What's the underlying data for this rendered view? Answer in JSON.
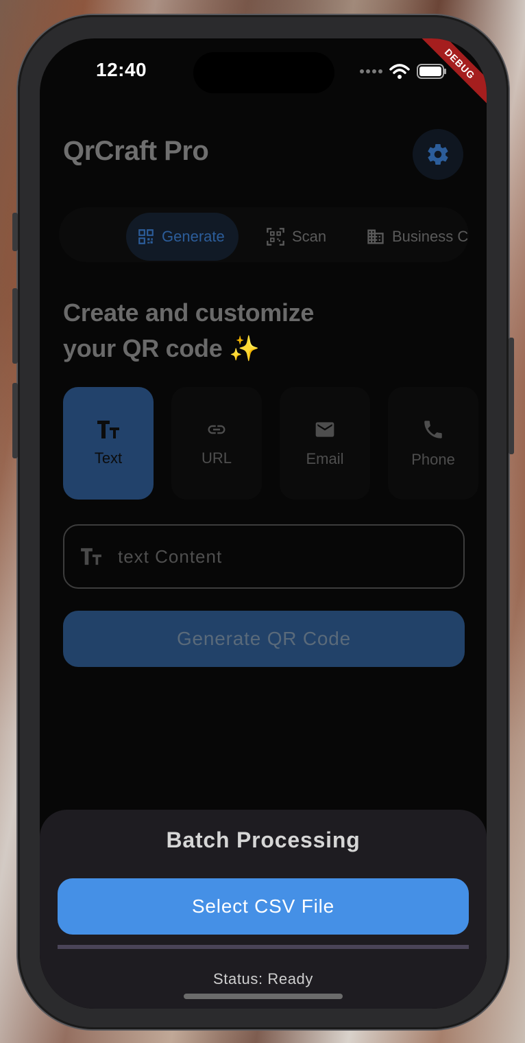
{
  "status_bar": {
    "time": "12:40"
  },
  "debug_banner": "DEBUG",
  "app": {
    "title": "QrCraft Pro"
  },
  "tabs": [
    {
      "label": "Generate",
      "icon": "qr-code-icon",
      "active": true
    },
    {
      "label": "Scan",
      "icon": "qr-scan-icon",
      "active": false
    },
    {
      "label": "Business C",
      "icon": "business-icon",
      "active": false
    }
  ],
  "headline": {
    "line1": "Create and customize",
    "line2": "your QR code ✨"
  },
  "content_types": [
    {
      "label": "Text",
      "icon": "text-icon",
      "active": true
    },
    {
      "label": "URL",
      "icon": "link-icon",
      "active": false
    },
    {
      "label": "Email",
      "icon": "email-icon",
      "active": false
    },
    {
      "label": "Phone",
      "icon": "phone-icon",
      "active": false
    }
  ],
  "input": {
    "placeholder": "text Content",
    "value": ""
  },
  "generate_button": {
    "label": "Generate QR Code"
  },
  "batch": {
    "title": "Batch Processing",
    "select_button": "Select CSV File",
    "progress": 0,
    "status": "Status: Ready"
  },
  "colors": {
    "accent": "#4590e6",
    "active_tab": "#2c5d9a",
    "sheet_bg": "#1e1c21",
    "debug_red": "#a51e1e"
  }
}
